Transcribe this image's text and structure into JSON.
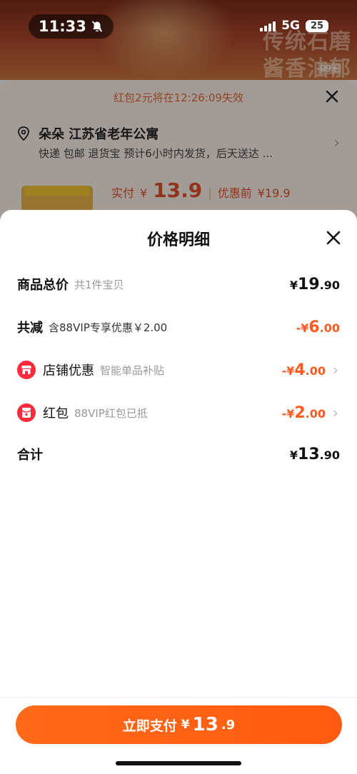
{
  "status_bar": {
    "time": "11:33",
    "network": "5G",
    "battery": "25"
  },
  "banner": {
    "ad_text": "传统石磨酱香油郁",
    "badge": "09+"
  },
  "order": {
    "notice": "红包2元将在12:26:09失效",
    "address": "朵朵 江苏省老年公寓",
    "shipping": "快递 包邮 退货宝 预计6小时内发货，后天送达 ...",
    "pay_label": "实付",
    "pay_currency": "¥",
    "pay_amount": "13.9",
    "before_label": "优惠前",
    "before_amount": "¥19.9"
  },
  "sheet": {
    "title": "价格明细",
    "rows": [
      {
        "label": "商品总价",
        "sub": "共1件宝贝",
        "currency": "¥",
        "int": "19",
        "dec": ".90"
      },
      {
        "label": "共减",
        "sub": "含88VIP专享优惠￥2.00",
        "currency": "-¥",
        "int": "6",
        "dec": ".00"
      },
      {
        "label": "店铺优惠",
        "sub": "智能单品补贴",
        "currency": "-¥",
        "int": "4",
        "dec": ".00",
        "icon": "shop-icon"
      },
      {
        "label": "红包",
        "sub": "88VIP红包已抵",
        "currency": "-¥",
        "int": "2",
        "dec": ".00",
        "icon": "red-packet-icon"
      },
      {
        "label": "合计",
        "sub": "",
        "currency": "¥",
        "int": "13",
        "dec": ".90"
      }
    ]
  },
  "pay_button": {
    "label": "立即支付",
    "currency": "¥",
    "int": "13",
    "dec": ".9"
  },
  "colors": {
    "accent": "#ff5a1f",
    "icon_red": "#ff2b3d"
  }
}
